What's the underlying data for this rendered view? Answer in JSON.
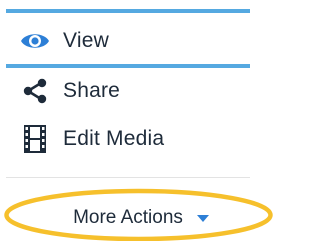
{
  "menu": {
    "items": [
      {
        "label": "View",
        "icon": "eye-icon"
      },
      {
        "label": "Share",
        "icon": "share-icon"
      },
      {
        "label": "Edit Media",
        "icon": "film-icon"
      }
    ],
    "more_actions": {
      "label": "More Actions",
      "icon": "caret-down-icon"
    }
  },
  "colors": {
    "accent_bar": "#55a9e1",
    "view_icon": "#2d7fd6",
    "caret": "#2d7fd6",
    "text": "#1e2b3a",
    "highlight_ellipse": "#f6c02c"
  }
}
